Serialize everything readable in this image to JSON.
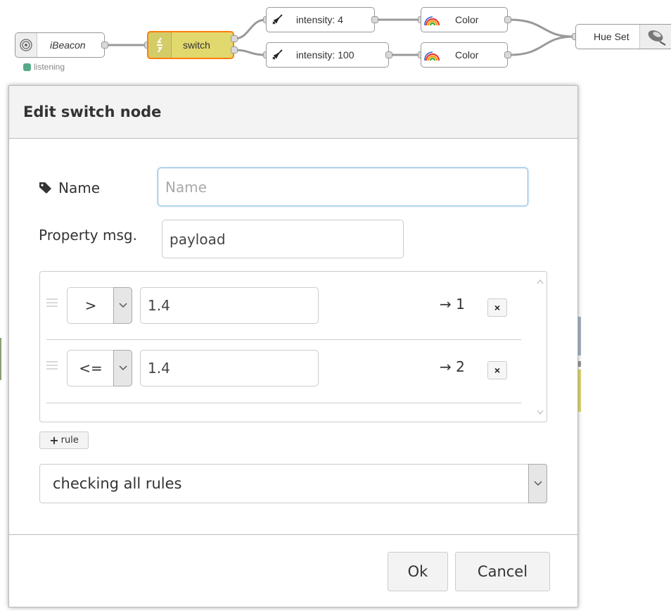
{
  "flow": {
    "ibeacon": {
      "label": "iBeacon",
      "status": "listening"
    },
    "switch": {
      "label": "switch"
    },
    "intensity_top": {
      "label": "intensity: 4"
    },
    "intensity_bottom": {
      "label": "intensity: 100"
    },
    "color_top": {
      "label": "Color"
    },
    "color_bottom": {
      "label": "Color"
    },
    "hue": {
      "label": "Hue Set"
    }
  },
  "dialog": {
    "title": "Edit switch node",
    "name_label": "Name",
    "name_placeholder": "Name",
    "name_value": "",
    "property_label": "Property msg.",
    "property_value": "payload",
    "rules": [
      {
        "operator": ">",
        "value": "1.4",
        "output": "→ 1",
        "delete_label": "×"
      },
      {
        "operator": "<=",
        "value": "1.4",
        "output": "→ 2",
        "delete_label": "×"
      }
    ],
    "add_rule_label": "rule",
    "mode_value": "checking all rules",
    "ok_label": "Ok",
    "cancel_label": "Cancel"
  },
  "colors": {
    "switch_node": "#e2d96e",
    "switch_selected_border": "#ff7f0e",
    "status_green": "#5a8",
    "input_focus_border": "#85b7d9"
  }
}
